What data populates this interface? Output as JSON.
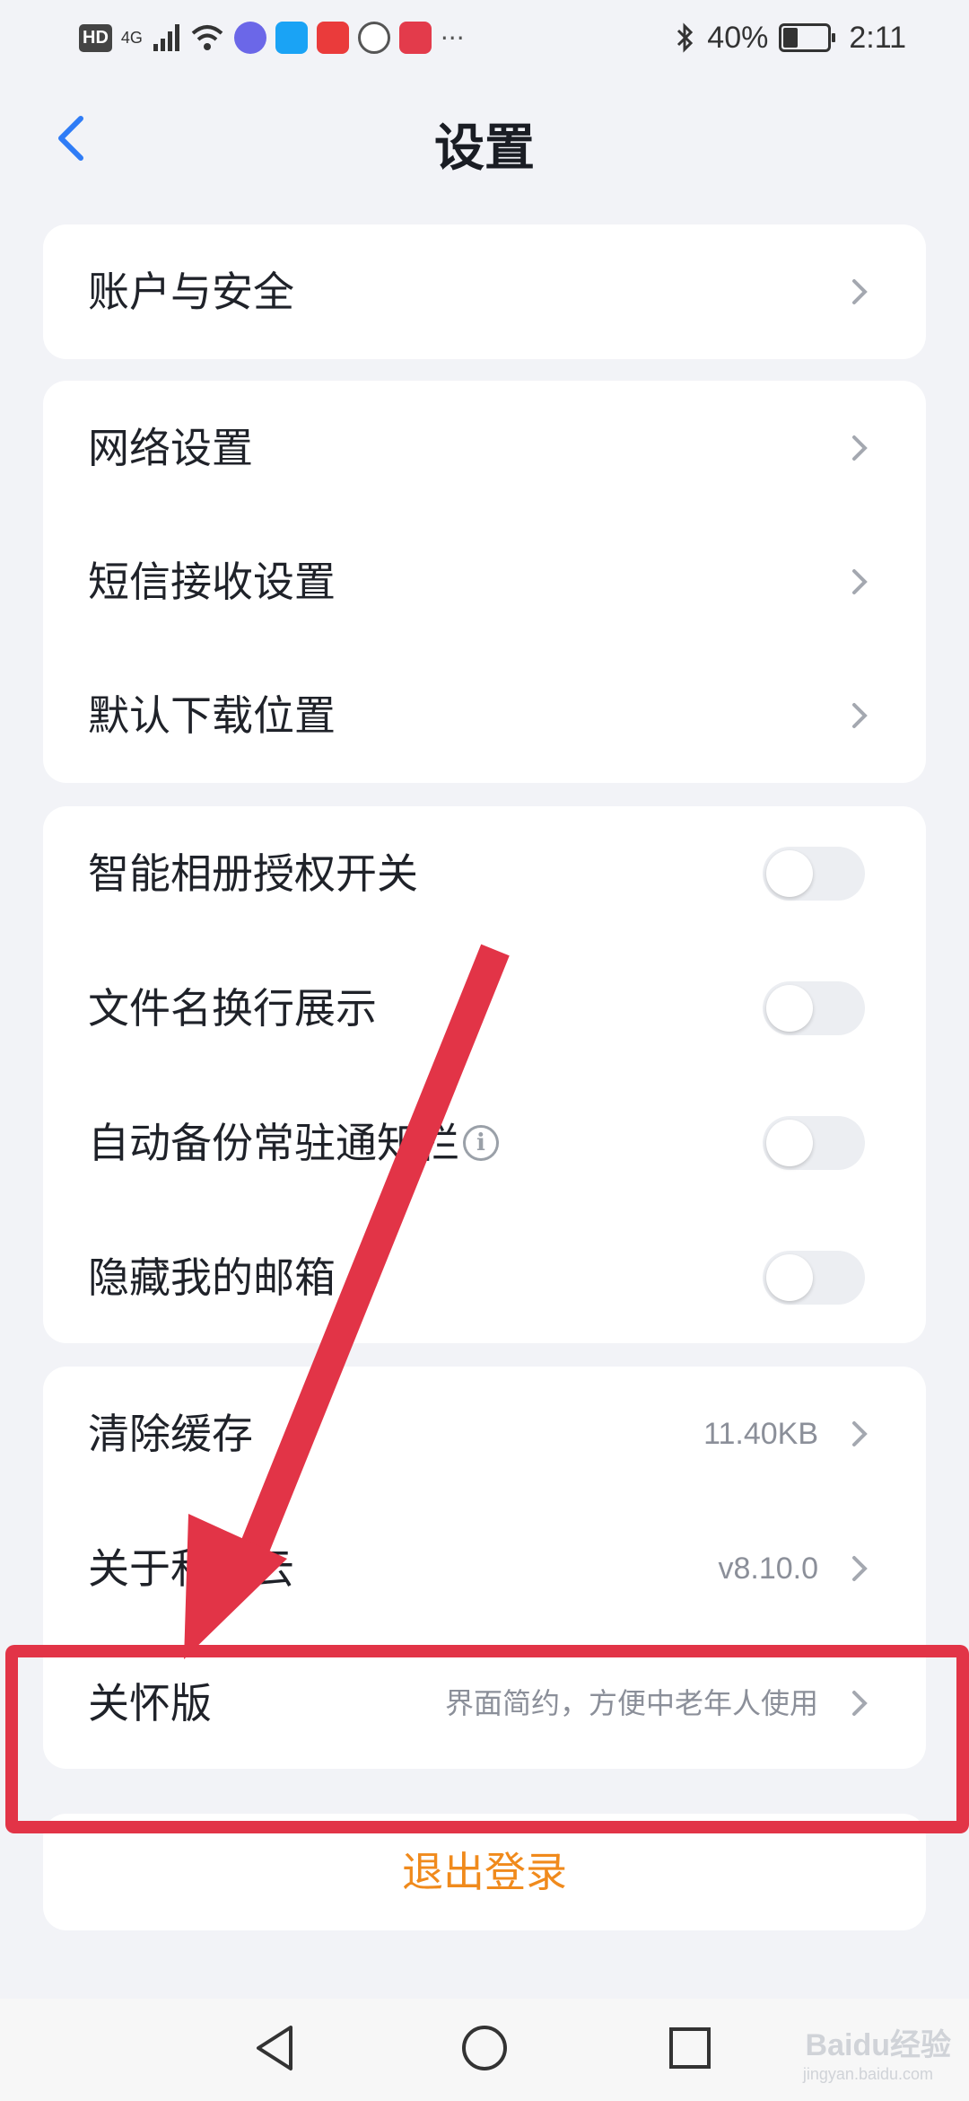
{
  "status_bar": {
    "hd": "HD",
    "network": "4G",
    "more": "···",
    "battery": "40%",
    "time": "2:11"
  },
  "header": {
    "title": "设置"
  },
  "section1": [
    {
      "label": "账户与安全"
    }
  ],
  "section2": [
    {
      "label": "网络设置"
    },
    {
      "label": "短信接收设置"
    },
    {
      "label": "默认下载位置"
    }
  ],
  "section3": [
    {
      "label": "智能相册授权开关",
      "enabled": false
    },
    {
      "label": "文件名换行展示",
      "enabled": false
    },
    {
      "label": "自动备份常驻通知栏",
      "enabled": false
    },
    {
      "label": "隐藏我的邮箱",
      "enabled": false
    }
  ],
  "section4": [
    {
      "label": "清除缓存",
      "value": "11.40KB"
    },
    {
      "label": "关于和彩云",
      "value": "v8.10.0"
    },
    {
      "label": "关怀版",
      "value": "界面简约，方便中老年人使用"
    }
  ],
  "logout_label": "退出登录",
  "colors": {
    "accent_blue": "#2f7cf6",
    "logout_orange": "#f08a1c",
    "annotation_red": "#e23447"
  },
  "watermark": {
    "main": "Baidu经验",
    "sub": "jingyan.baidu.com"
  }
}
